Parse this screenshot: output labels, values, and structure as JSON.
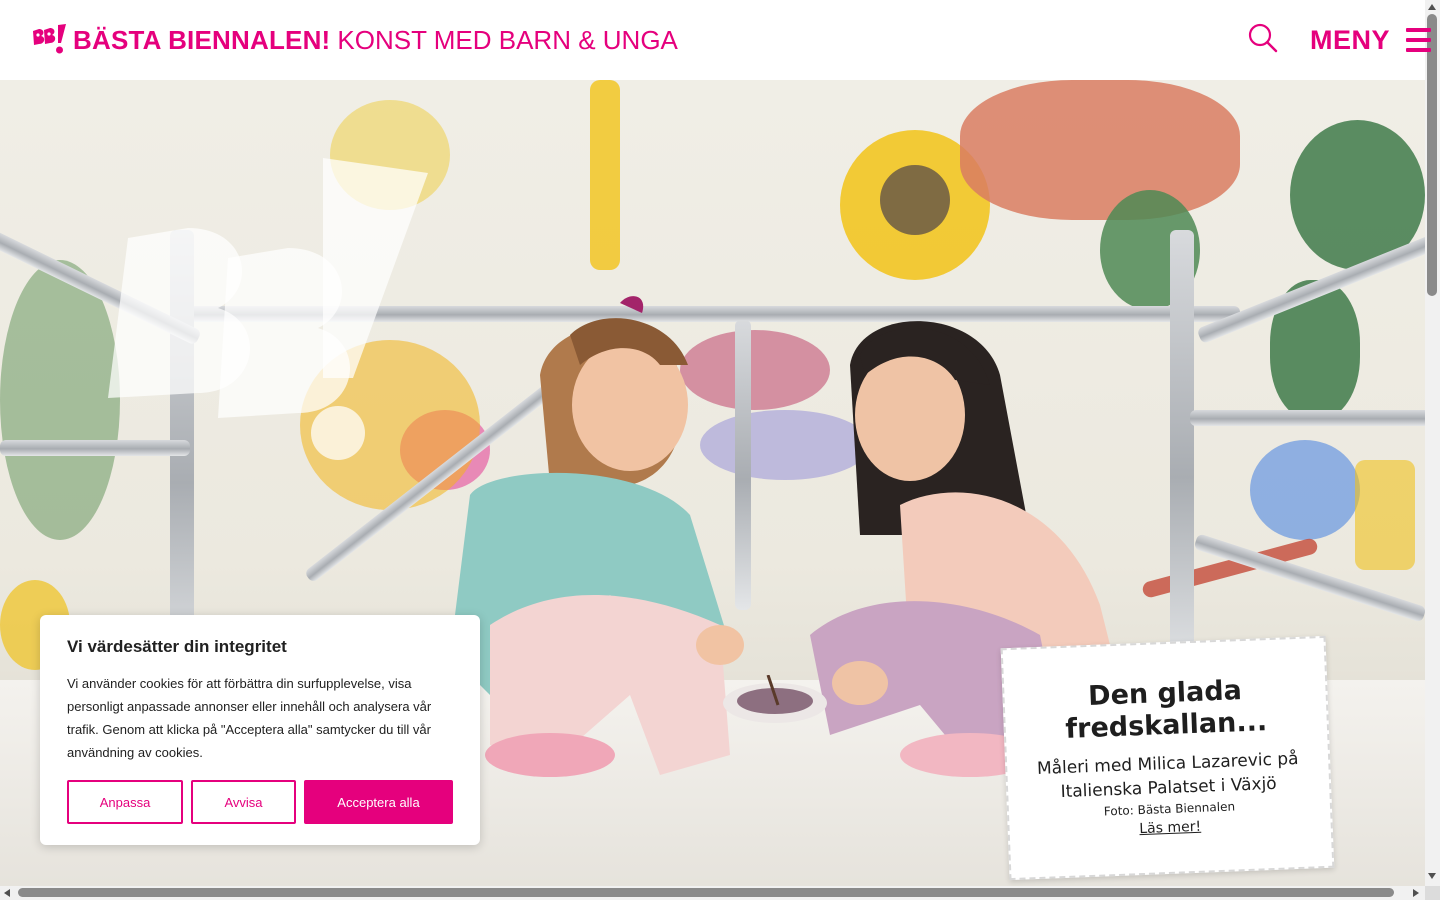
{
  "brand": {
    "name": "BÄSTA BIENNALEN!",
    "tagline": "KONST MED BARN & UNGA",
    "color": "#e5007d"
  },
  "header": {
    "search_icon": "search-icon",
    "menu_label": "MENY",
    "menu_icon": "hamburger-icon"
  },
  "feature": {
    "title": "Den glada fredskallan...",
    "subtitle": "Måleri med Milica Lazarevic på Italienska Palatset i Växjö",
    "credit": "Foto: Bästa Biennalen",
    "link": "Läs mer!"
  },
  "cookie": {
    "title": "Vi värdesätter din integritet",
    "text": "Vi använder cookies för att förbättra din surfupplevelse, visa personligt anpassade annonser eller innehåll och analysera vår trafik. Genom att klicka på \"Acceptera alla\" samtycker du till vår användning av cookies.",
    "customize_label": "Anpassa",
    "reject_label": "Avvisa",
    "accept_label": "Acceptera alla"
  }
}
